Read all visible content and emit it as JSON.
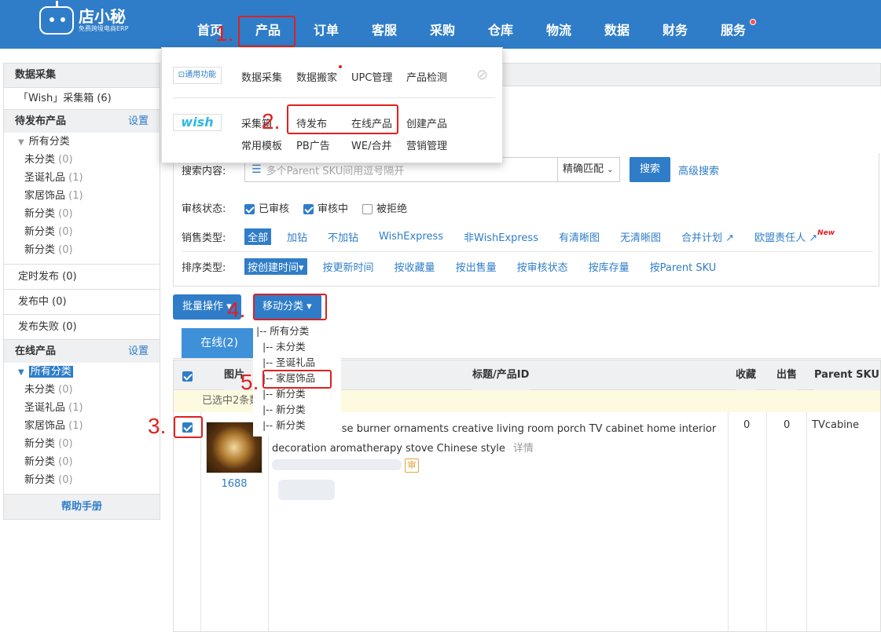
{
  "brand": {
    "name": "店小秘",
    "subtitle": "免费跨境电商ERP"
  },
  "nav": [
    "首页",
    "产品",
    "订单",
    "客服",
    "采购",
    "仓库",
    "物流",
    "数据",
    "财务",
    "服务"
  ],
  "steps": [
    "1.",
    "2.",
    "3.",
    "4.",
    "5."
  ],
  "sidebar": {
    "collect_title": "数据采集",
    "collect_box": "「Wish」采集箱 (6)",
    "pending_title": "待发布产品",
    "settings": "设置",
    "all_category": "所有分类",
    "categories": [
      {
        "name": "未分类",
        "count": "(0)"
      },
      {
        "name": "圣诞礼品",
        "count": "(1)"
      },
      {
        "name": "家居饰品",
        "count": "(1)"
      },
      {
        "name": "新分类",
        "count": "(0)"
      },
      {
        "name": "新分类",
        "count": "(0)"
      },
      {
        "name": "新分类",
        "count": "(0)"
      }
    ],
    "scheduled": "定时发布  (0)",
    "publishing": "发布中  (0)",
    "failed": "发布失败  (0)",
    "online_title": "在线产品",
    "online_categories": [
      {
        "name": "未分类",
        "count": "(0)"
      },
      {
        "name": "圣诞礼品",
        "count": "(1)"
      },
      {
        "name": "家居饰品",
        "count": "(1)"
      },
      {
        "name": "新分类",
        "count": "(0)"
      },
      {
        "name": "新分类",
        "count": "(0)"
      },
      {
        "name": "新分类",
        "count": "(0)"
      }
    ],
    "help": "帮助手册"
  },
  "dropdown": {
    "general_logo": "通用功能",
    "general_items": [
      "数据采集",
      "数据搬家",
      "UPC管理",
      "产品检测"
    ],
    "wish_logo": "wish",
    "wish_row1": [
      "采集箱",
      "待发布",
      "在线产品",
      "创建产品"
    ],
    "wish_row2": [
      "常用模板",
      "PB广告",
      "WE/合并",
      "营销管理"
    ]
  },
  "filters": {
    "search_label": "搜索内容:",
    "search_placeholder": "多个Parent SKU间用逗号隔开",
    "match": "精确匹配",
    "search_btn": "搜索",
    "advanced": "高级搜索",
    "audit_label": "审核状态:",
    "audit_opts": [
      "已审核",
      "审核中",
      "被拒绝"
    ],
    "sales_label": "销售类型:",
    "sales_opts": [
      "全部",
      "加钻",
      "不加钻",
      "WishExpress",
      "非WishExpress",
      "有清晰图",
      "无清晰图",
      "合并计划",
      "欧盟责任人"
    ],
    "new_badge": "New",
    "sort_label": "排序类型:",
    "sort_opts": [
      "按创建时间▾",
      "按更新时间",
      "按收藏量",
      "按出售量",
      "按审核状态",
      "按库存量",
      "按Parent SKU"
    ]
  },
  "actions": {
    "batch": "批量操作 ▾",
    "move": "移动分类 ▾"
  },
  "tab_online": "在线(2)",
  "category_menu": [
    "|-- 所有分类",
    "  |-- 未分类",
    "  |-- 圣诞礼品",
    "  |-- 家居饰品",
    "  |-- 新分类",
    "  |-- 新分类",
    "  |-- 新分类"
  ],
  "table": {
    "headers": {
      "image": "图片",
      "title": "标题/产品ID",
      "fav": "收藏",
      "sold": "出售",
      "psku": "Parent SKU"
    },
    "selected_text": "已选中2条数",
    "row": {
      "source": "1688",
      "title": "ackflow incense burner ornaments creative living room porch TV cabinet home interior decoration aromatherapy stove Chinese style",
      "detail": "详情",
      "audit": "审",
      "fav": "0",
      "sold": "0",
      "psku": "TVcabine"
    }
  },
  "colors": {
    "primary": "#2f7dc8",
    "annotation": "#e02020"
  }
}
